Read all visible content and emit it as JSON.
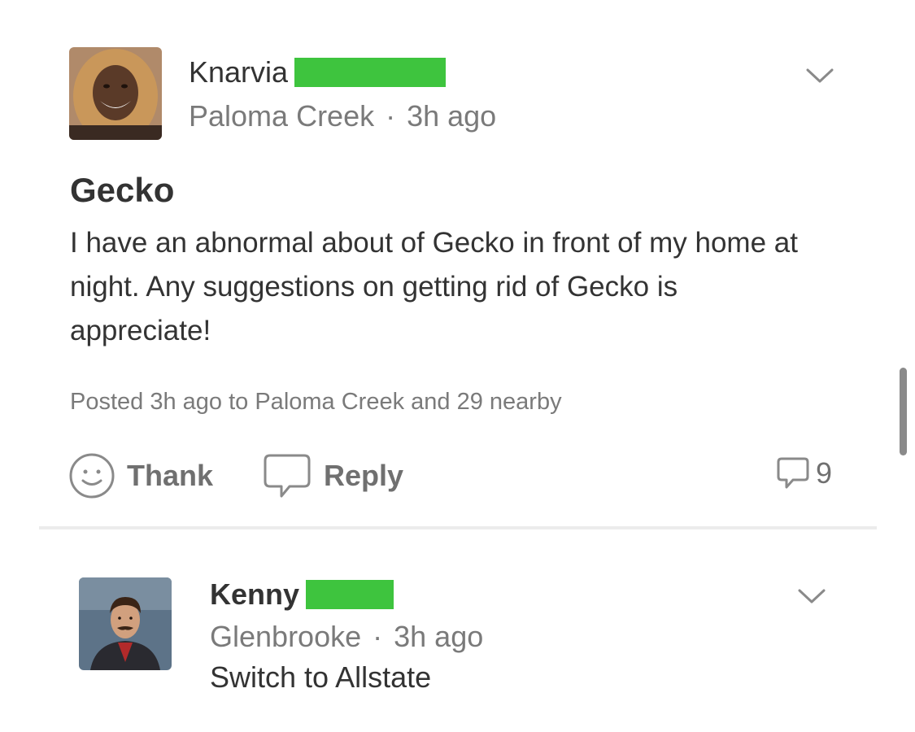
{
  "post": {
    "author": {
      "name": "Knarvia",
      "location": "Paloma Creek",
      "time": "3h ago"
    },
    "title": "Gecko",
    "body": "I have an abnormal about of Gecko in front of my home at night. Any suggestions on getting rid of Gecko is appreciate!",
    "posted_info": "Posted 3h ago to Paloma Creek and 29 nearby",
    "actions": {
      "thank_label": "Thank",
      "reply_label": "Reply",
      "comment_count": "9"
    },
    "separator": "·"
  },
  "comment": {
    "author": {
      "name": "Kenny",
      "location": "Glenbrooke",
      "time": "3h ago"
    },
    "text": "Switch to Allstate"
  },
  "colors": {
    "redaction": "#3ec43e",
    "text_primary": "#333333",
    "text_secondary": "#7a7a7a",
    "icon": "#707070"
  },
  "icons": {
    "post_menu": "chevron-down-icon",
    "thank": "smiley-icon",
    "reply": "speech-bubble-icon",
    "comments": "comment-bubble-icon"
  }
}
